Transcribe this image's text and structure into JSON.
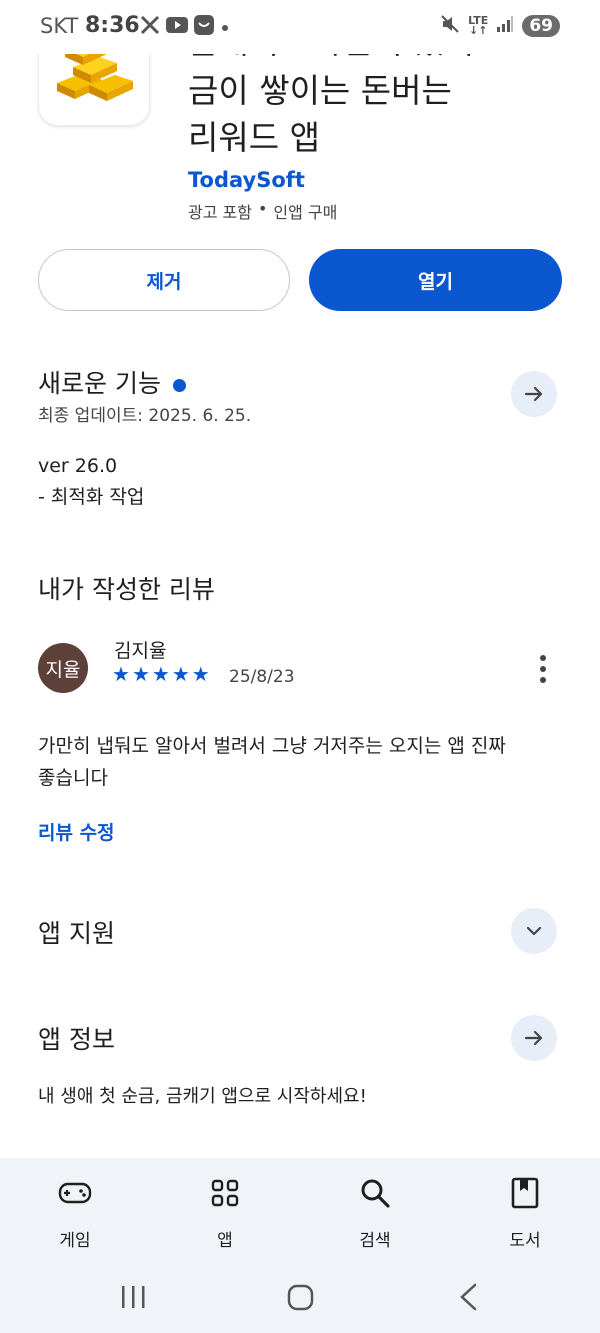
{
  "status_bar": {
    "carrier": "SKT",
    "time": "8:36",
    "network": "LTE",
    "battery": "69"
  },
  "app": {
    "title_cut_line": "금캐기 - 가만히 있어도",
    "title_line2": "금이 쌓이는 돈버는",
    "title_line3": "리워드 앱",
    "developer": "TodaySoft",
    "meta_ads": "광고 포함",
    "meta_iap": "인앱 구매"
  },
  "actions": {
    "uninstall_label": "제거",
    "open_label": "열기"
  },
  "whats_new": {
    "title": "새로운 기능",
    "updated": "최종 업데이트: 2025. 6. 25.",
    "version": "ver 26.0",
    "note": "- 최적화 작업"
  },
  "my_review": {
    "title": "내가 작성한 리뷰",
    "avatar_text": "지율",
    "reviewer": "김지율",
    "rating": 5,
    "stars": [
      "★",
      "★",
      "★",
      "★",
      "★"
    ],
    "date": "25/8/23",
    "text_line1": "가만히 냅둬도 알아서 벌려서 그냥 거저주는 오지는 앱 진짜",
    "text_line2": "좋습니다",
    "edit_link": "리뷰 수정"
  },
  "app_support": {
    "title": "앱 지원"
  },
  "app_info": {
    "title": "앱 정보",
    "description": "내 생애 첫 순금, 금캐기 앱으로 시작하세요!"
  },
  "bottom_nav": {
    "items": [
      {
        "label": "게임",
        "icon": "gamepad-icon"
      },
      {
        "label": "앱",
        "icon": "apps-grid-icon"
      },
      {
        "label": "검색",
        "icon": "search-icon"
      },
      {
        "label": "도서",
        "icon": "book-icon"
      }
    ]
  },
  "colors": {
    "accent": "#0b57d0",
    "nav_bg": "#f0f4f9",
    "avatar_bg": "#5d4037"
  }
}
